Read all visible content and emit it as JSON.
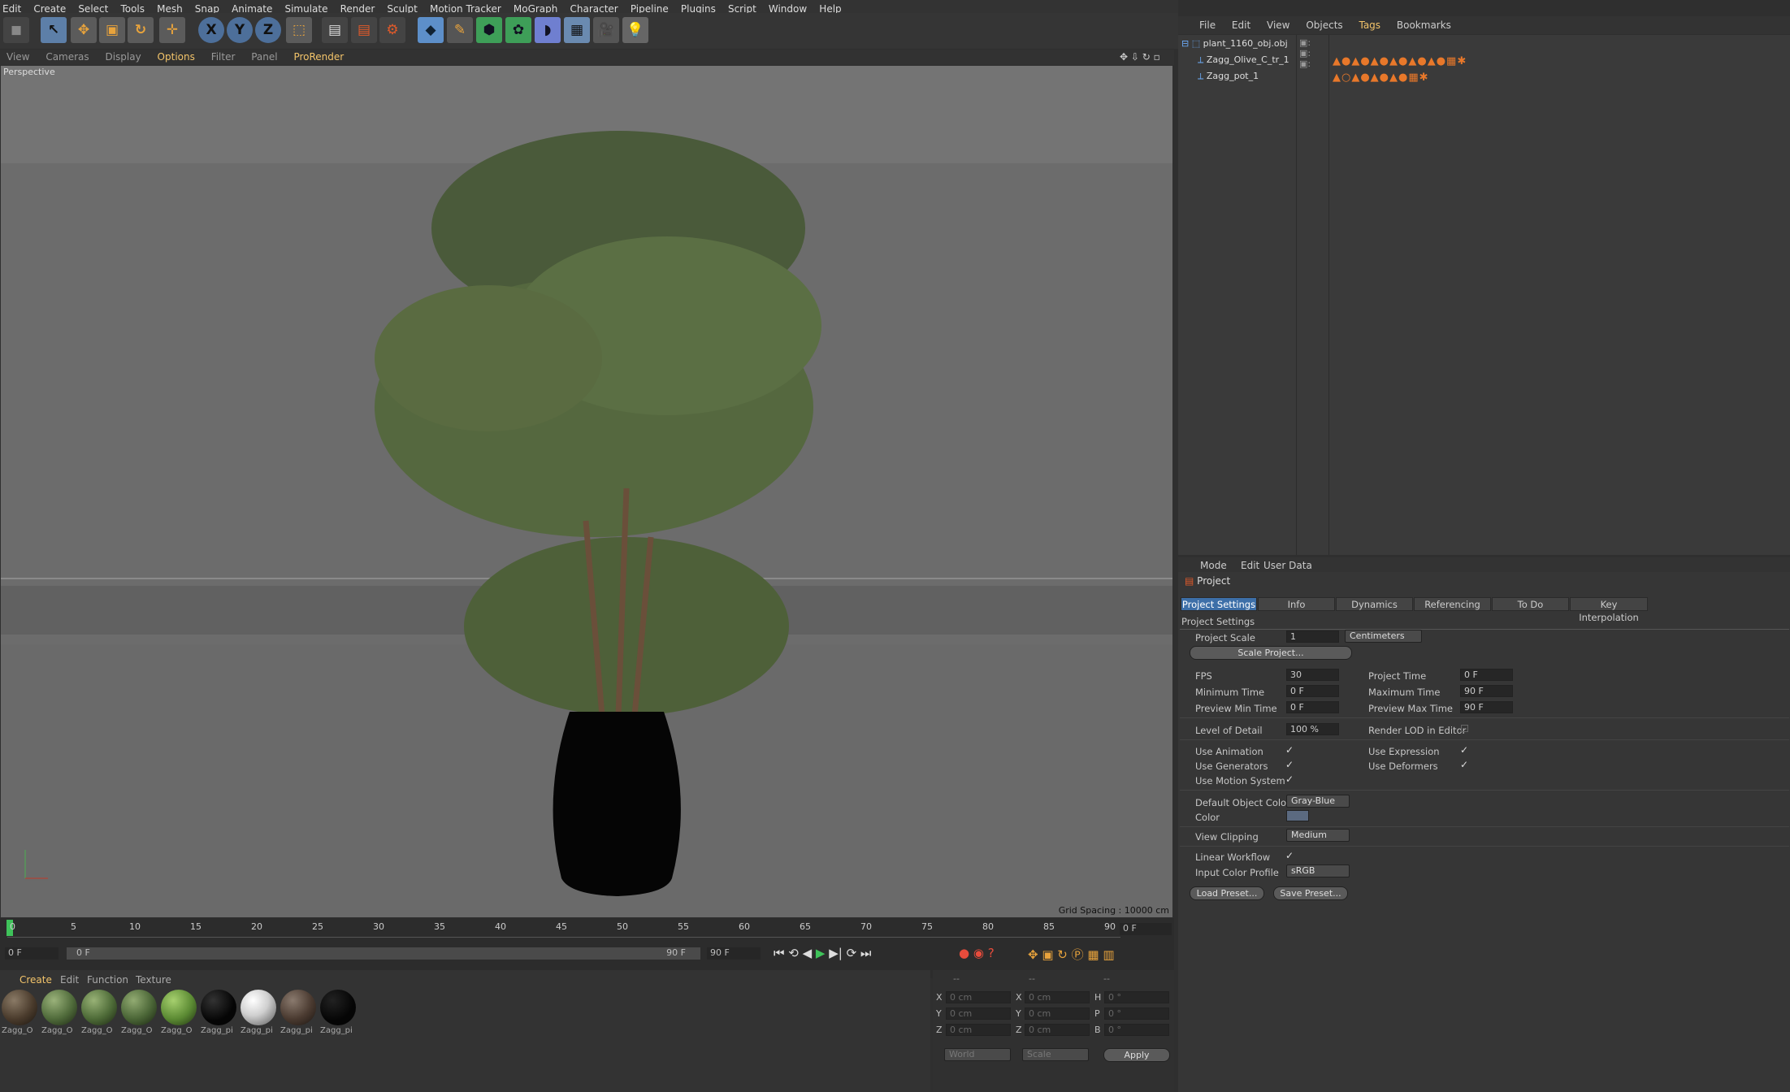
{
  "menubar": [
    "Edit",
    "Create",
    "Select",
    "Tools",
    "Mesh",
    "Snap",
    "Animate",
    "Simulate",
    "Render",
    "Sculpt",
    "Motion Tracker",
    "MoGraph",
    "Character",
    "Pipeline",
    "Plugins",
    "Script",
    "Window",
    "Help"
  ],
  "viewport": {
    "menu": [
      "View",
      "Cameras",
      "Display",
      "Options",
      "Filter",
      "Panel",
      "ProRender"
    ],
    "label": "Perspective",
    "grid_spacing": "Grid Spacing : 10000 cm"
  },
  "timeline": {
    "ticks": [
      "0",
      "5",
      "10",
      "15",
      "20",
      "25",
      "30",
      "35",
      "40",
      "45",
      "50",
      "55",
      "60",
      "65",
      "70",
      "75",
      "80",
      "85",
      "90"
    ],
    "current": "0 F",
    "start": "0 F",
    "range_start": "0 F",
    "range_end": "90 F",
    "end": "90 F",
    "frame_field": "0 F"
  },
  "material_manager": {
    "menu": [
      "Create",
      "Edit",
      "Function",
      "Texture"
    ],
    "materials": [
      {
        "label": "Zagg_O",
        "color": "#4a3b2c"
      },
      {
        "label": "Zagg_O",
        "color": "#4f6a3a"
      },
      {
        "label": "Zagg_O",
        "color": "#4d6a37"
      },
      {
        "label": "Zagg_O",
        "color": "#4a6536"
      },
      {
        "label": "Zagg_O",
        "color": "#5b8a33"
      },
      {
        "label": "Zagg_pi",
        "color": "#050505"
      },
      {
        "label": "Zagg_pi",
        "color": "#cfcfcf"
      },
      {
        "label": "Zagg_pi",
        "color": "#4a3a30"
      },
      {
        "label": "Zagg_pi",
        "color": "#050505"
      }
    ]
  },
  "coords": {
    "header": [
      "--",
      "--",
      "--"
    ],
    "rows": [
      {
        "a": "X",
        "av": "0 cm",
        "b": "X",
        "bv": "0 cm",
        "c": "H",
        "cv": "0 °"
      },
      {
        "a": "Y",
        "av": "0 cm",
        "b": "Y",
        "bv": "0 cm",
        "c": "P",
        "cv": "0 °"
      },
      {
        "a": "Z",
        "av": "0 cm",
        "b": "Z",
        "bv": "0 cm",
        "c": "B",
        "cv": "0 °"
      }
    ],
    "world": "World",
    "scale": "Scale",
    "apply": "Apply"
  },
  "object_manager": {
    "menu": [
      "File",
      "Edit",
      "View",
      "Objects",
      "Tags",
      "Bookmarks"
    ],
    "objects": [
      "plant_1160_obj.obj",
      "Zagg_Olive_C_tr_1",
      "Zagg_pot_1"
    ]
  },
  "attributes": {
    "menu": [
      "Mode",
      "Edit",
      "User Data"
    ],
    "title": "Project",
    "tabs": [
      "Project Settings",
      "Info",
      "Dynamics",
      "Referencing",
      "To Do",
      "Key Interpolation"
    ],
    "section": "Project Settings",
    "project_scale_label": "Project Scale",
    "project_scale": "1",
    "scale_unit": "Centimeters",
    "scale_project": "Scale Project...",
    "fps_label": "FPS",
    "fps": "30",
    "project_time_label": "Project Time",
    "project_time": "0 F",
    "min_time_label": "Minimum Time",
    "min_time": "0 F",
    "max_time_label": "Maximum Time",
    "max_time": "90 F",
    "prev_min_label": "Preview Min Time",
    "prev_min": "0 F",
    "prev_max_label": "Preview Max Time",
    "prev_max": "90 F",
    "lod_label": "Level of Detail",
    "lod": "100 %",
    "render_lod_label": "Render LOD in Editor",
    "use_anim": "Use Animation",
    "use_expr": "Use Expression",
    "use_gen": "Use Generators",
    "use_def": "Use Deformers",
    "use_motion": "Use Motion System",
    "def_color_label": "Default Object Color",
    "def_color": "Gray-Blue",
    "color_label": "Color",
    "view_clip_label": "View Clipping",
    "view_clip": "Medium",
    "linear_label": "Linear Workflow",
    "icp_label": "Input Color Profile",
    "icp": "sRGB",
    "load_preset": "Load Preset...",
    "save_preset": "Save Preset..."
  }
}
